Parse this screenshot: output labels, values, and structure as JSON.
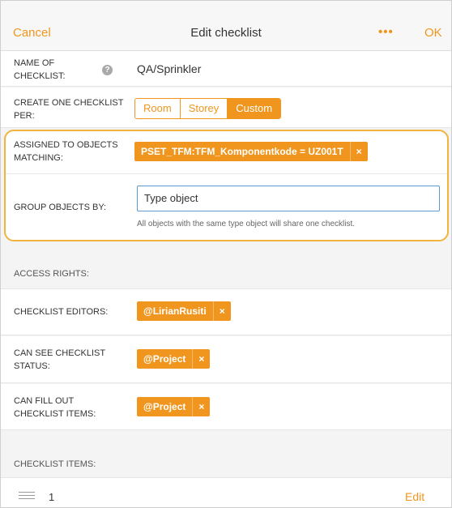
{
  "header": {
    "cancel_label": "Cancel",
    "title": "Edit checklist",
    "more_label": "•••",
    "ok_label": "OK"
  },
  "name_row": {
    "label_line1": "NAME OF",
    "label_line2": "CHECKLIST:",
    "help_icon": "?",
    "value": "QA/Sprinkler"
  },
  "per_row": {
    "label_line1": "CREATE ONE CHECKLIST",
    "label_line2": "PER:",
    "options": [
      "Room",
      "Storey",
      "Custom"
    ],
    "selected": "Custom"
  },
  "assigned_row": {
    "label_line1": "ASSIGNED TO OBJECTS",
    "label_line2": "MATCHING:",
    "tag": "PSET_TFM:TFM_Komponentkode = UZ001T",
    "remove_icon": "×"
  },
  "group_row": {
    "label": "GROUP OBJECTS BY:",
    "value": "Type object",
    "hint": "All objects with the same type object will share one checklist."
  },
  "access_rights": {
    "section_label": "ACCESS RIGHTS:",
    "editors": {
      "label": "CHECKLIST EDITORS:",
      "tag": "@LirianRusiti"
    },
    "can_see": {
      "label_line1": "CAN SEE CHECKLIST",
      "label_line2": "STATUS:",
      "tag": "@Project"
    },
    "can_fill": {
      "label_line1": "CAN FILL OUT",
      "label_line2": "CHECKLIST ITEMS:",
      "tag": "@Project"
    },
    "remove_icon": "×"
  },
  "checklist_items": {
    "section_label": "CHECKLIST ITEMS:",
    "items": [
      {
        "number": "1",
        "edit_label": "Edit"
      }
    ]
  },
  "colors": {
    "accent": "#f0961e",
    "highlight_border": "#f0b43c",
    "input_border": "#5b9bd5"
  }
}
